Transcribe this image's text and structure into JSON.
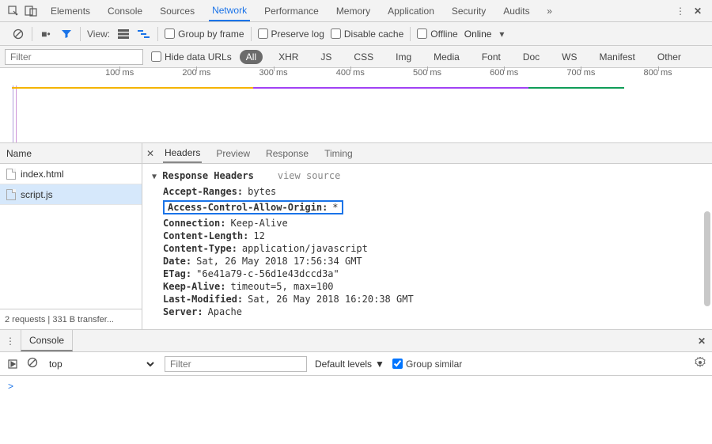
{
  "topTabs": [
    "Elements",
    "Console",
    "Sources",
    "Network",
    "Performance",
    "Memory",
    "Application",
    "Security",
    "Audits"
  ],
  "topActive": 3,
  "subbar": {
    "viewLabel": "View:",
    "groupByFrame": "Group by frame",
    "preserveLog": "Preserve log",
    "disableCache": "Disable cache",
    "offline": "Offline",
    "online": "Online"
  },
  "filterBar": {
    "filterPlaceholder": "Filter",
    "hideData": "Hide data URLs",
    "types": [
      "All",
      "XHR",
      "JS",
      "CSS",
      "Img",
      "Media",
      "Font",
      "Doc",
      "WS",
      "Manifest",
      "Other"
    ],
    "activeType": 0
  },
  "timeline": {
    "ticks": [
      "100 ms",
      "200 ms",
      "300 ms",
      "400 ms",
      "500 ms",
      "600 ms",
      "700 ms",
      "800 ms"
    ]
  },
  "names": {
    "header": "Name",
    "rows": [
      "index.html",
      "script.js"
    ],
    "selected": 1,
    "status": "2 requests | 331 B transfer..."
  },
  "detail": {
    "tabs": [
      "Headers",
      "Preview",
      "Response",
      "Timing"
    ],
    "activeTab": 0,
    "sectionTitle": "Response Headers",
    "viewSource": "view source",
    "headers": [
      {
        "k": "Accept-Ranges:",
        "v": "bytes"
      },
      {
        "k": "Access-Control-Allow-Origin:",
        "v": "*",
        "hl": true
      },
      {
        "k": "Connection:",
        "v": "Keep-Alive"
      },
      {
        "k": "Content-Length:",
        "v": "12"
      },
      {
        "k": "Content-Type:",
        "v": "application/javascript"
      },
      {
        "k": "Date:",
        "v": "Sat, 26 May 2018 17:56:34 GMT"
      },
      {
        "k": "ETag:",
        "v": "\"6e41a79-c-56d1e43dccd3a\""
      },
      {
        "k": "Keep-Alive:",
        "v": "timeout=5, max=100"
      },
      {
        "k": "Last-Modified:",
        "v": "Sat, 26 May 2018 16:20:38 GMT"
      },
      {
        "k": "Server:",
        "v": "Apache"
      }
    ]
  },
  "drawer": {
    "title": "Console",
    "context": "top",
    "filterPlaceholder": "Filter",
    "levels": "Default levels",
    "groupSimilar": "Group similar",
    "prompt": ">"
  }
}
